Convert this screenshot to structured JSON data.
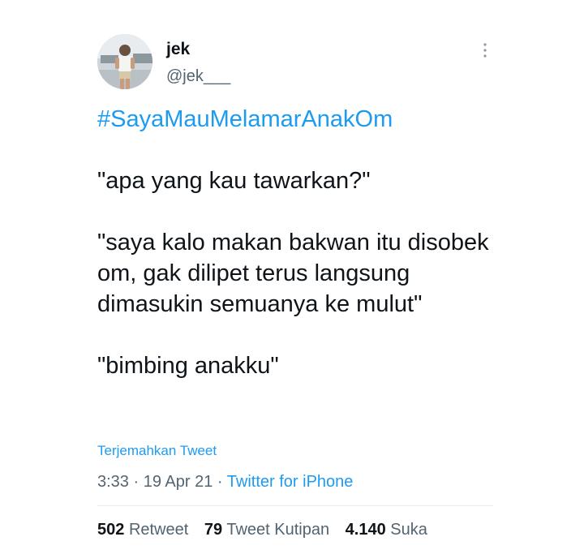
{
  "author": {
    "display_name": "jek",
    "handle": "@jek___"
  },
  "tweet": {
    "hashtag": "#SayaMauMelamarAnakOm",
    "paragraphs": [
      "\"apa yang kau tawarkan?\"",
      "\"saya kalo makan bakwan itu disobek om, gak dilipet terus langsung dimasukin semuanya ke mulut\"",
      "\"bimbing anakku\""
    ],
    "translate_label": "Terjemahkan Tweet",
    "time": "3:33",
    "date": "19 Apr 21",
    "separator": "·",
    "source": "Twitter for iPhone"
  },
  "stats": {
    "retweets": "502",
    "retweets_label": "Retweet",
    "quotes": "79",
    "quotes_label": "Tweet Kutipan",
    "likes": "4.140",
    "likes_label": "Suka"
  },
  "icons": {
    "more": "more-vertical-icon",
    "avatar": "profile-photo"
  },
  "colors": {
    "link": "#1d9bf0",
    "text": "#0f1419",
    "muted": "#536471"
  }
}
